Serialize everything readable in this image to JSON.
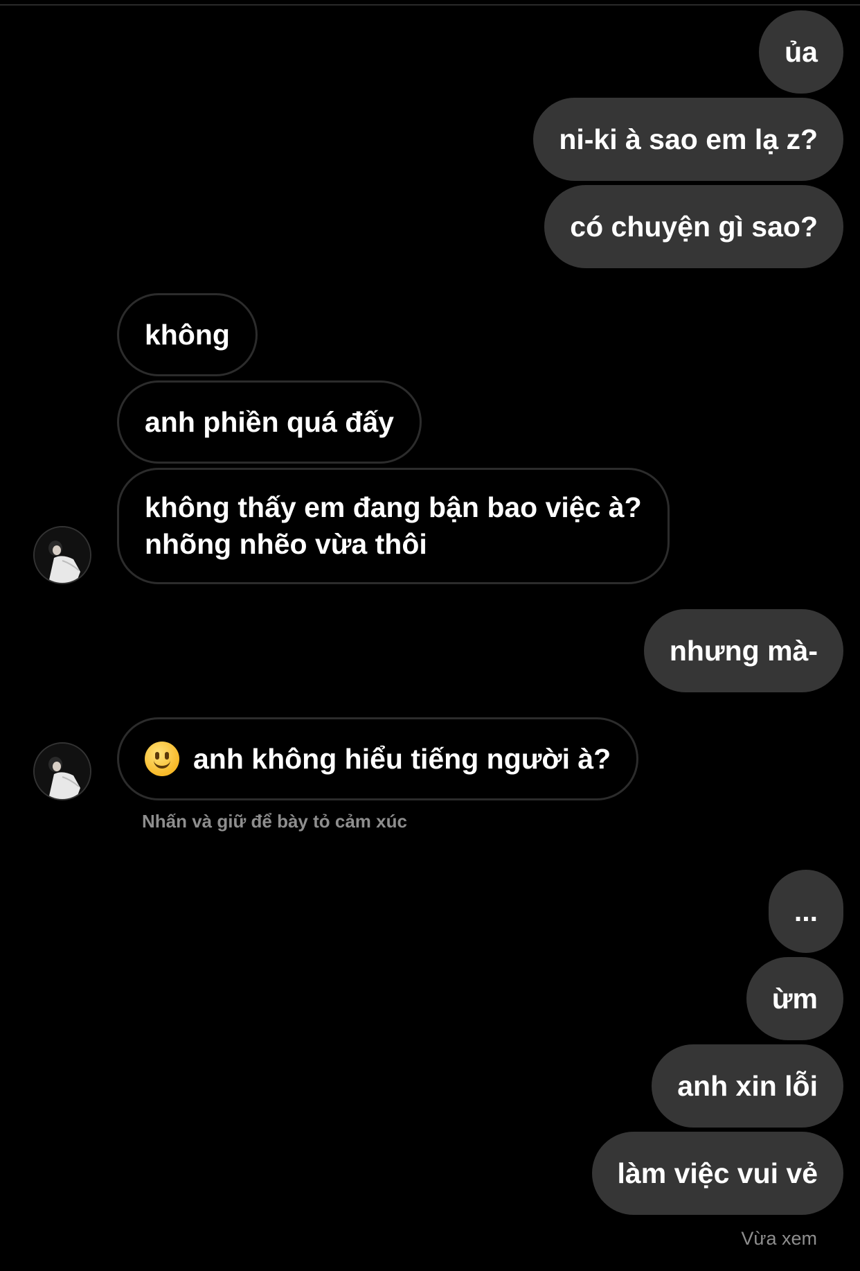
{
  "messages": [
    {
      "sender": "me",
      "text": "ủa"
    },
    {
      "sender": "me",
      "text": "ni-ki à sao em lạ z?"
    },
    {
      "sender": "me",
      "text": "có chuyện gì sao?"
    },
    {
      "sender": "them",
      "text": "không"
    },
    {
      "sender": "them",
      "text": "anh phiền quá đấy"
    },
    {
      "sender": "them",
      "lines": [
        "không thấy em đang bận bao việc à?",
        "nhõng nhẽo vừa thôi"
      ]
    },
    {
      "sender": "me",
      "text": "nhưng mà-"
    },
    {
      "sender": "them",
      "emoji": "slightly-smiling-face-icon",
      "text": "anh không hiểu tiếng người à?"
    },
    {
      "sender": "me",
      "text": "..."
    },
    {
      "sender": "me",
      "text": "ừm"
    },
    {
      "sender": "me",
      "text": "anh xin lỗi"
    },
    {
      "sender": "me",
      "text": "làm việc vui vẻ"
    }
  ],
  "reaction_hint": "Nhấn và giữ để bày tỏ cảm xúc",
  "seen_status": "Vừa xem",
  "colors": {
    "background": "#000000",
    "sent_bubble": "#363636",
    "received_border": "#2c2c2c",
    "meta_text": "#8e8e8e"
  }
}
